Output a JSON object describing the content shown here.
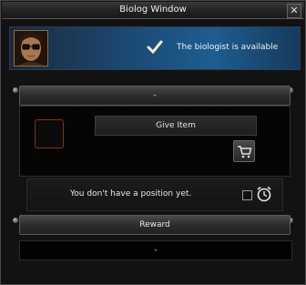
{
  "window": {
    "title": "Biolog Window",
    "close_glyph": "✕"
  },
  "banner": {
    "status": "The biologist is available",
    "check_icon": "checkmark-icon"
  },
  "task_section": {
    "header": "-"
  },
  "give_item": {
    "label": "Give Item",
    "cart_icon": "shopping-cart-icon"
  },
  "position_status": {
    "text": "You don't have a position yet.",
    "alarm_icon": "alarm-clock-icon"
  },
  "reward": {
    "header": "Reward",
    "value": "-"
  },
  "colors": {
    "banner_accent": "#1d5d91",
    "slot_border": "#8b2a22",
    "portrait_frame": "#8c6a3a"
  }
}
